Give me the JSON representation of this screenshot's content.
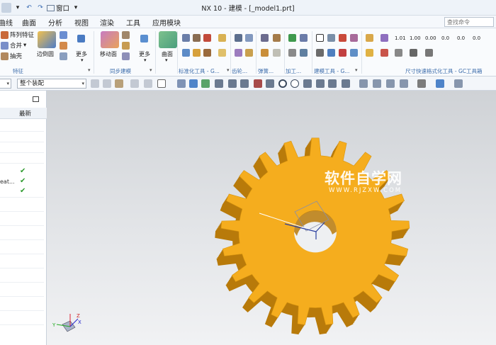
{
  "app": {
    "window_title": "NX 10 - 建模 - [_model1.prt]",
    "quick_access_window_label": "窗口",
    "search_placeholder": "查找命令"
  },
  "menu": {
    "items": [
      "曲线",
      "曲面",
      "分析",
      "视图",
      "渲染",
      "工具",
      "应用模块"
    ]
  },
  "ribbon": {
    "groups": {
      "feature": {
        "label": "特征",
        "items": [
          "阵列特征",
          "合并",
          "抽壳"
        ],
        "big": "边倒圆",
        "more": "更多"
      },
      "sync": {
        "label": "同步建模",
        "big": "移动面",
        "more": "更多"
      },
      "surface": {
        "big": "曲面"
      },
      "std_tools": {
        "label": "标准化工具 - G..."
      },
      "gear": {
        "label": "齿轮..."
      },
      "spring": {
        "label": "弹簧..."
      },
      "machining": {
        "label": "加工..."
      },
      "modeling_tools": {
        "label": "建模工具 - G..."
      },
      "dim_tools": {
        "label": "尺寸快速格式化工具 - GC工具箱"
      },
      "dim_buttons": [
        "1.01",
        "1.00",
        "0.00",
        "0.0",
        "0.0",
        "0.0"
      ]
    }
  },
  "toolbar": {
    "filter_value": "",
    "assembly_scope": "整个装配"
  },
  "navigator": {
    "column_latest": "最新",
    "partial_text": "eat..."
  },
  "viewport": {
    "watermark_cn": "软件自学网",
    "watermark_en": "WWW.RJZXW.COM",
    "triad_labels": [
      "Z",
      "Y",
      "X"
    ]
  },
  "gear": {
    "tooth_count": 21,
    "fill_color": "#f5ad1e",
    "side_color": "#b87a0a"
  },
  "colors": {
    "check": "#2e9a2e",
    "group_label": "#3c6cab"
  }
}
